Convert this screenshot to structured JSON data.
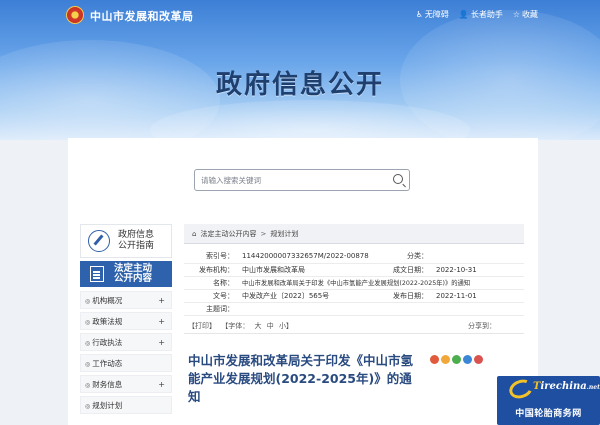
{
  "header": {
    "site_name": "中山市发展和改革局",
    "links": [
      {
        "icon": "accessibility-icon",
        "glyph": "♿",
        "label": "无障碍"
      },
      {
        "icon": "elder-mode-icon",
        "glyph": "👤",
        "label": "长者助手"
      },
      {
        "icon": "star-icon",
        "glyph": "☆",
        "label": "收藏"
      }
    ],
    "banner_title": "政府信息公开"
  },
  "search": {
    "placeholder": "请输入搜索关键词"
  },
  "sidebar": {
    "top_item": "政府信息\n公开指南",
    "active_item": "法定主动\n公开内容",
    "menu": [
      {
        "label": "机构概况",
        "expand": "+"
      },
      {
        "label": "政策法规",
        "expand": "+"
      },
      {
        "label": "行政执法",
        "expand": "+"
      },
      {
        "label": "工作动态",
        "expand": ""
      },
      {
        "label": "财务信息",
        "expand": "+"
      },
      {
        "label": "规划计划",
        "expand": ""
      }
    ]
  },
  "breadcrumb": {
    "items": [
      "法定主动公开内容",
      "规划计划"
    ],
    "separator": ">"
  },
  "info": {
    "index_label": "索引号：",
    "index_value": "11442000007332657M/2022-00878",
    "category_label": "分类：",
    "category_value": "",
    "publisher_label": "发布机构：",
    "publisher_value": "中山市发展和改革局",
    "created_label": "成文日期：",
    "created_value": "2022-10-31",
    "name_label": "名称：",
    "name_value": "中山市发展和改革局关于印发《中山市氢能产业发展规划(2022-2025年)》的通知",
    "docno_label": "文号：",
    "docno_value": "中发改产业〔2022〕565号",
    "pubdate_label": "发布日期：",
    "pubdate_value": "2022-11-01",
    "topic_label": "主题词：",
    "topic_value": ""
  },
  "actions": {
    "print": "【打印】",
    "font_label": "【字体：",
    "font_large": "大",
    "font_mid": "中",
    "font_small": "小】",
    "share": "分享到："
  },
  "document": {
    "title": "中山市发展和改革局关于印发《中山市氢能产业发展规划(2022-2025年)》的通知"
  },
  "share_colors": [
    "#e05a3b",
    "#f1a73a",
    "#4cae4f",
    "#3b86d6",
    "#d9534f"
  ],
  "watermark": {
    "brand_prefix": "T",
    "brand_main": "irechina",
    "brand_suffix": ".net",
    "subtitle": "中国轮胎商务网"
  }
}
